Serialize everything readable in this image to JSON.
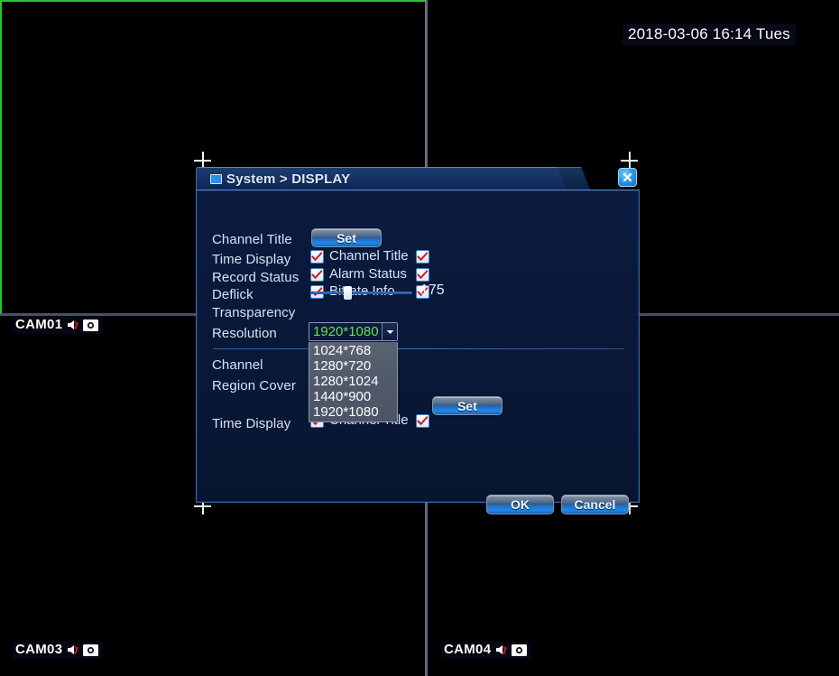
{
  "osd": {
    "timestamp": "2018-03-06 16:14 Tues",
    "channels": [
      {
        "name": "CAM01",
        "audio_icon": "audio-mute-icon",
        "record_icon": "record-camera-icon"
      },
      {
        "name": "CAM03",
        "audio_icon": "audio-mute-icon",
        "record_icon": "record-camera-icon"
      },
      {
        "name": "CAM04",
        "audio_icon": "audio-mute-icon",
        "record_icon": "record-camera-icon"
      }
    ]
  },
  "dialog": {
    "title": "System > DISPLAY",
    "title_icon": "monitor-icon",
    "close_icon": "close-x-icon",
    "labels": {
      "channel_title": "Channel Title",
      "time_display": "Time Display",
      "record_status": "Record Status",
      "deflick": "Deflick",
      "transparency": "Transparency",
      "resolution": "Resolution",
      "channel": "Channel",
      "region_cover": "Region Cover",
      "time_display_2": "Time Display"
    },
    "inline_labels": {
      "channel_title": "Channel Title",
      "alarm_status": "Alarm Status",
      "bitrate_info": "Bitrate Info",
      "channel_title_2": "Channel Title"
    },
    "buttons": {
      "set_channel_title": "Set",
      "set_time_display": "Set",
      "ok": "OK",
      "cancel": "Cancel"
    },
    "transparency": {
      "value": "175",
      "percent": 33
    },
    "resolution": {
      "selected": "1920*1080",
      "options": [
        "1024*768",
        "1280*720",
        "1280*1024",
        "1440*900",
        "1920*1080"
      ],
      "dropdown_open": true,
      "arrow_icon": "chevron-down-icon"
    },
    "checkboxes": {
      "time_display": true,
      "channel_title": true,
      "record_status": true,
      "alarm_status": true,
      "deflick": true,
      "bitrate_info": true,
      "time_display_2": true,
      "channel_title_2": true
    }
  },
  "colors": {
    "accent_blue": "#2289e6",
    "selected_channel_border": "#25c825",
    "combo_value_green": "#63e34a",
    "checkmark_red": "#d32020",
    "dialog_bg": "#0a1838"
  }
}
